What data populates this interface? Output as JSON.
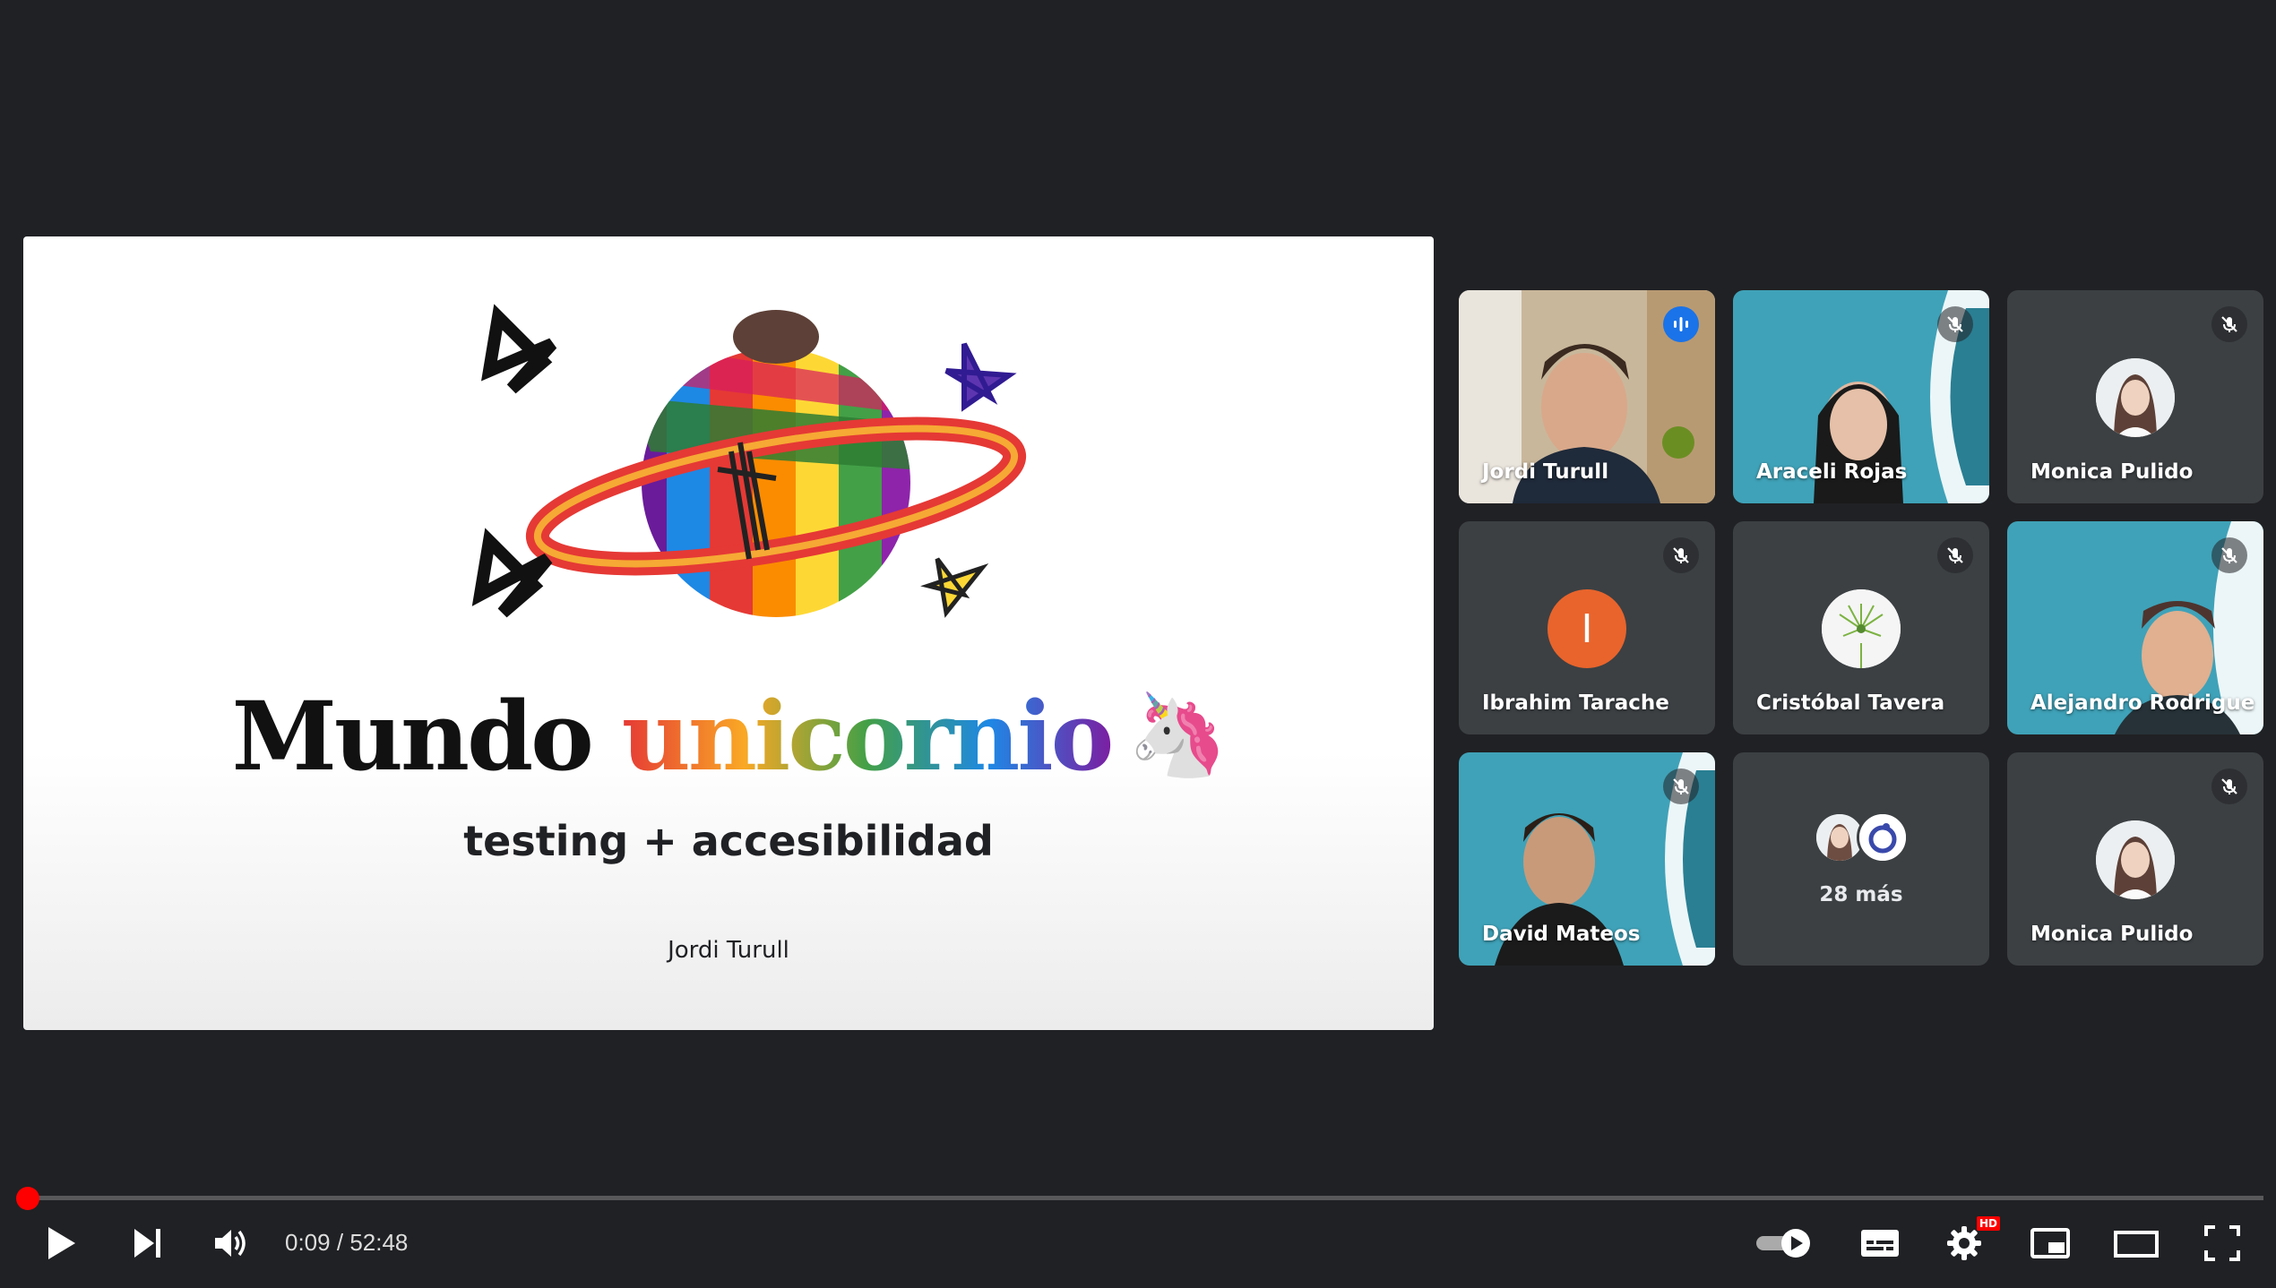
{
  "slide": {
    "title_part1": "Mundo",
    "title_part2": "unicornio",
    "title_emoji": "🦄",
    "subtitle": "testing + accesibilidad",
    "author": "Jordi Turull"
  },
  "participants": [
    {
      "name": "Jordi Turull",
      "status": "speaking",
      "mic_icon": "audio-activity-icon"
    },
    {
      "name": "Araceli Rojas",
      "status": "muted",
      "mic_icon": "mic-off-icon"
    },
    {
      "name": "Monica Pulido",
      "status": "muted",
      "mic_icon": "mic-off-icon"
    },
    {
      "name": "Ibrahim Tarache",
      "status": "muted",
      "mic_icon": "mic-off-icon",
      "avatar_letter": "I",
      "avatar_color": "#e8642c"
    },
    {
      "name": "Cristóbal Tavera",
      "status": "muted",
      "mic_icon": "mic-off-icon"
    },
    {
      "name": "Alejandro Rodrigue",
      "status": "muted",
      "mic_icon": "mic-off-icon"
    },
    {
      "name": "David Mateos",
      "status": "muted",
      "mic_icon": "mic-off-icon"
    },
    {
      "name": "Monica Pulido",
      "status": "muted",
      "mic_icon": "mic-off-icon"
    }
  ],
  "more_participants": {
    "label": "28 más"
  },
  "player": {
    "current_time": "0:09",
    "separator": "/",
    "duration": "52:48",
    "progress_fraction": 0.003,
    "hd_badge": "HD",
    "accent_color": "#ff0000",
    "controls": [
      "play-icon",
      "next-icon",
      "volume-icon",
      "autoplay-toggle",
      "subtitles-icon",
      "settings-icon",
      "miniplayer-icon",
      "theater-icon",
      "fullscreen-icon"
    ]
  }
}
